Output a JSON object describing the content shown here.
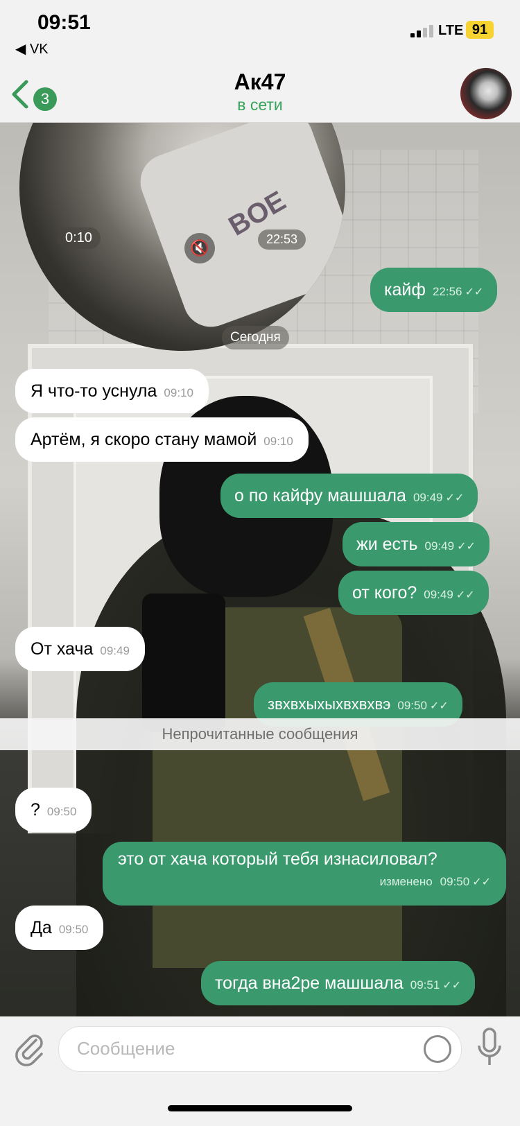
{
  "status_bar": {
    "time": "09:51",
    "back_app": "◀ VK",
    "network": "LTE",
    "battery": "91"
  },
  "header": {
    "back_badge": "3",
    "title": "Ак47",
    "status": "в сети"
  },
  "video_message": {
    "duration": "0:10",
    "time": "22:53",
    "shirt_text": "BOE"
  },
  "date_separator": "Сегодня",
  "unread_separator": "Непрочитанные сообщения",
  "messages": [
    {
      "dir": "out",
      "text": "кайф",
      "time": "22:56"
    },
    {
      "dir": "in",
      "text": "Я что-то уснула",
      "time": "09:10"
    },
    {
      "dir": "in",
      "text": "Артём, я скоро стану мамой",
      "time": "09:10"
    },
    {
      "dir": "out",
      "text": "о по кайфу машшала",
      "time": "09:49"
    },
    {
      "dir": "out",
      "text": "жи есть",
      "time": "09:49"
    },
    {
      "dir": "out",
      "text": "от кого?",
      "time": "09:49"
    },
    {
      "dir": "in",
      "text": "От хача",
      "time": "09:49"
    },
    {
      "dir": "out",
      "text": "звхвхыхыхвхвхвэ",
      "time": "09:50"
    },
    {
      "dir": "in",
      "text": "?",
      "time": "09:50"
    },
    {
      "dir": "out",
      "text": "это от хача который тебя изнасиловал?",
      "time": "09:50",
      "edited": "изменено"
    },
    {
      "dir": "in",
      "text": "Да",
      "time": "09:50"
    },
    {
      "dir": "out",
      "text": "тогда вна2ре машшала",
      "time": "09:51"
    }
  ],
  "composer": {
    "placeholder": "Сообщение"
  },
  "colors": {
    "accent": "#3a9a5a",
    "outgoing_bubble": "#3a9a6d",
    "incoming_bubble": "#ffffff"
  }
}
